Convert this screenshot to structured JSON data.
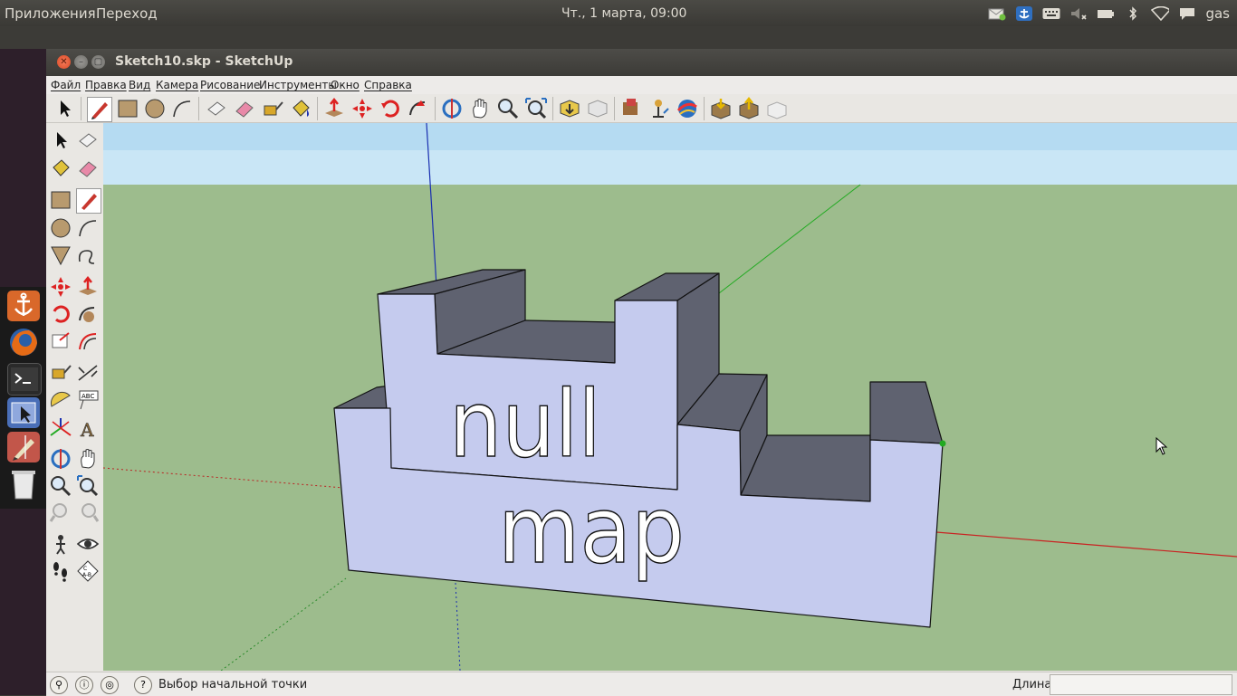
{
  "top_panel": {
    "apps_menu": "Приложения",
    "places_menu": "Переход",
    "clock": "Чт., 1 марта, 09:00",
    "user": "gas",
    "tray_icons": [
      "mail-icon",
      "anchor-icon",
      "keyboard-icon",
      "volume-muted-icon",
      "battery-icon",
      "bluetooth-icon",
      "wifi-icon",
      "chat-icon"
    ]
  },
  "launcher": {
    "items": [
      "anchor-icon",
      "firefox-icon",
      "terminal-icon",
      "window-select-icon",
      "sketchup-icon",
      "trash-icon"
    ]
  },
  "window": {
    "title": "Sketch10.skp - SketchUp"
  },
  "menubar": {
    "items": [
      "Файл",
      "Правка",
      "Вид",
      "Камера",
      "Рисование",
      "Инструменты",
      "Окно",
      "Справка"
    ]
  },
  "toolbar": {
    "tools": [
      "select-icon",
      "pencil-icon",
      "rectangle-icon",
      "circle-icon",
      "arc-icon",
      "eraser-block-icon",
      "eraser-icon",
      "tape-icon",
      "paint-bucket-icon",
      "push-pull-icon",
      "move-icon",
      "rotate-icon",
      "follow-me-icon",
      "orbit-icon",
      "pan-icon",
      "zoom-icon",
      "zoom-extents-icon",
      "get-models-icon",
      "share-model-icon",
      "component-icon",
      "place-model-icon",
      "google-earth-icon",
      "import-icon",
      "export-icon",
      "preview-icon"
    ]
  },
  "left_tools": {
    "tools": [
      "select-icon",
      "make-component-icon",
      "paint-bucket-icon",
      "eraser-icon",
      "rectangle-icon",
      "line-icon",
      "circle-icon",
      "arc-icon",
      "polygon-icon",
      "freehand-icon",
      "move-icon",
      "push-pull-icon",
      "rotate-icon",
      "follow-me-icon",
      "scale-icon",
      "offset-icon",
      "tape-measure-icon",
      "dimension-icon",
      "protractor-icon",
      "text-icon",
      "axes-icon",
      "3d-text-icon",
      "orbit-icon",
      "pan-icon",
      "zoom-icon",
      "zoom-window-icon",
      "previous-view-icon",
      "next-view-icon",
      "position-camera-icon",
      "look-around-icon",
      "walk-icon",
      "section-plane-icon"
    ]
  },
  "model": {
    "text_line1": "null",
    "text_line2": "map"
  },
  "statusbar": {
    "message": "Выбор начальной точки",
    "length_label": "Длина",
    "length_value": ""
  },
  "colors": {
    "sky": "#c9e6f6",
    "ground": "#9dbc8d",
    "face_front": "#c5cbee",
    "face_top": "#5f6270",
    "axis_red": "#c92222",
    "axis_green": "#22aa22",
    "axis_blue": "#1a2fb0"
  }
}
